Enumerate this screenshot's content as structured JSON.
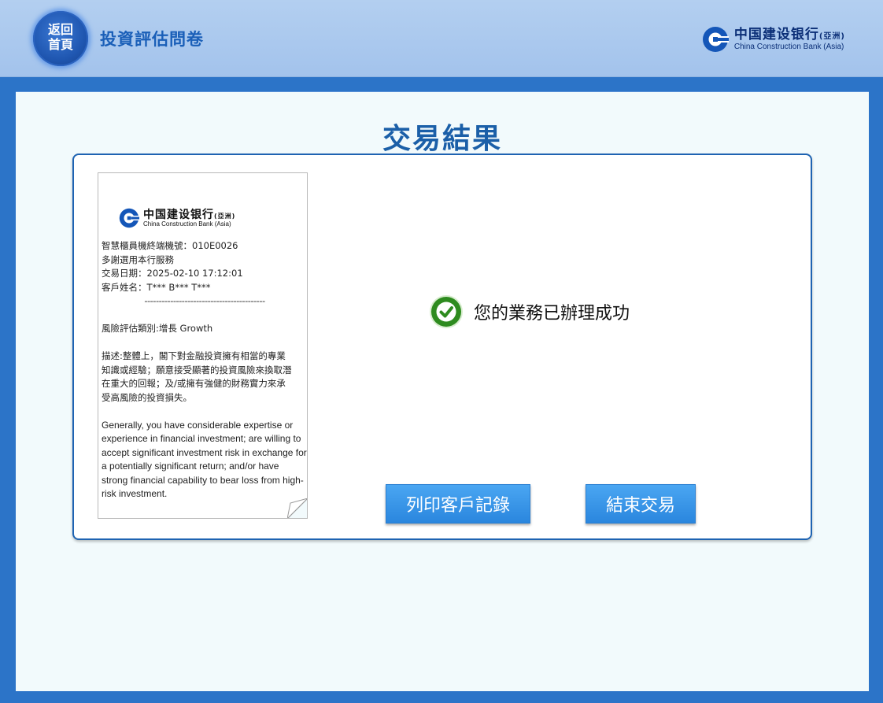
{
  "header": {
    "home_button_line1": "返回",
    "home_button_line2": "首頁",
    "title": "投資評估問卷",
    "brand_cn": "中国建设银行",
    "brand_cn_suffix": "(亞洲)",
    "brand_en": "China Construction Bank (Asia)"
  },
  "main": {
    "title": "交易結果",
    "success_message": "您的業務已辦理成功",
    "print_button": "列印客戶記錄",
    "end_button": "結束交易"
  },
  "receipt": {
    "brand_cn": "中国建设银行",
    "brand_cn_suffix": "(亞洲)",
    "brand_en": "China Construction Bank (Asia)",
    "terminal_line": "智慧櫃員機終端機號：010E0026",
    "thanks_line": "多謝選用本行服務",
    "date_line": "交易日期：2025-02-10 17:12:01",
    "name_line": "客戶姓名：T*** B*** T***",
    "divider": "------------------------------------------",
    "risk_line": "風險評估類別:增長 Growth",
    "desc_line1": "描述:整體上，閣下對金融投資擁有相當的專業",
    "desc_line2": "知識或經驗；願意接受顯著的投資風險來換取潛",
    "desc_line3": "在重大的回報；及/或擁有強健的財務實力來承",
    "desc_line4": "受高風險的投資損失。",
    "en_description": "Generally, you have considerable expertise or experience in financial investment; are willing to accept significant investment risk in exchange for a potentially significant return; and/or have strong financial capability to bear loss from high-risk investment."
  },
  "colors": {
    "accent_blue": "#1b5fa8",
    "button_blue": "#3597e8",
    "success_green": "#2e8b1f",
    "frame_blue": "#2c74c8"
  },
  "icons": [
    "ccb-logo-icon",
    "check-circle-icon",
    "page-fold-icon"
  ]
}
